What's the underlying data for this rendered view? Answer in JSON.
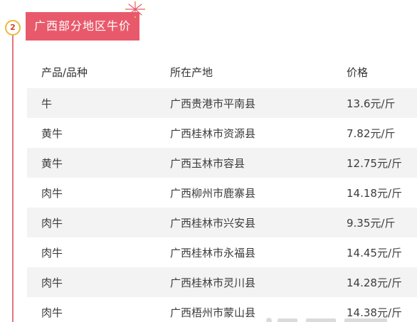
{
  "section": {
    "number": "2",
    "title": "广西部分地区牛价"
  },
  "table": {
    "headers": [
      "产品/品种",
      "所在产地",
      "价格"
    ],
    "rows": [
      {
        "product": "牛",
        "location": "广西贵港市平南县",
        "price": "13.6元/斤"
      },
      {
        "product": "黄牛",
        "location": "广西桂林市资源县",
        "price": "7.82元/斤"
      },
      {
        "product": "黄牛",
        "location": "广西玉林市容县",
        "price": "12.75元/斤"
      },
      {
        "product": "肉牛",
        "location": "广西柳州市鹿寨县",
        "price": "14.18元/斤"
      },
      {
        "product": "肉牛",
        "location": "广西桂林市兴安县",
        "price": "9.35元/斤"
      },
      {
        "product": "肉牛",
        "location": "广西桂林市永福县",
        "price": "14.45元/斤"
      },
      {
        "product": "肉牛",
        "location": "广西桂林市灵川县",
        "price": "14.28元/斤"
      },
      {
        "product": "肉牛",
        "location": "广西梧州市蒙山县",
        "price": "14.38元/斤"
      }
    ]
  },
  "colors": {
    "accent": "#e85a6b",
    "timeline": "#e8737f",
    "badge_border": "#f0b63b",
    "row_stripe": "#f3f3f3"
  }
}
